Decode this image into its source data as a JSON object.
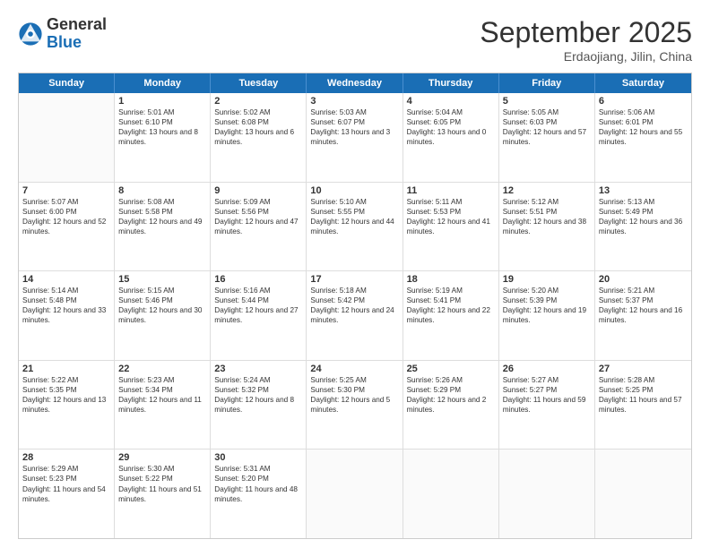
{
  "header": {
    "logo_general": "General",
    "logo_blue": "Blue",
    "month_title": "September 2025",
    "location": "Erdaojiang, Jilin, China"
  },
  "weekdays": [
    "Sunday",
    "Monday",
    "Tuesday",
    "Wednesday",
    "Thursday",
    "Friday",
    "Saturday"
  ],
  "rows": [
    [
      {
        "day": "",
        "sunrise": "",
        "sunset": "",
        "daylight": ""
      },
      {
        "day": "1",
        "sunrise": "Sunrise: 5:01 AM",
        "sunset": "Sunset: 6:10 PM",
        "daylight": "Daylight: 13 hours and 8 minutes."
      },
      {
        "day": "2",
        "sunrise": "Sunrise: 5:02 AM",
        "sunset": "Sunset: 6:08 PM",
        "daylight": "Daylight: 13 hours and 6 minutes."
      },
      {
        "day": "3",
        "sunrise": "Sunrise: 5:03 AM",
        "sunset": "Sunset: 6:07 PM",
        "daylight": "Daylight: 13 hours and 3 minutes."
      },
      {
        "day": "4",
        "sunrise": "Sunrise: 5:04 AM",
        "sunset": "Sunset: 6:05 PM",
        "daylight": "Daylight: 13 hours and 0 minutes."
      },
      {
        "day": "5",
        "sunrise": "Sunrise: 5:05 AM",
        "sunset": "Sunset: 6:03 PM",
        "daylight": "Daylight: 12 hours and 57 minutes."
      },
      {
        "day": "6",
        "sunrise": "Sunrise: 5:06 AM",
        "sunset": "Sunset: 6:01 PM",
        "daylight": "Daylight: 12 hours and 55 minutes."
      }
    ],
    [
      {
        "day": "7",
        "sunrise": "Sunrise: 5:07 AM",
        "sunset": "Sunset: 6:00 PM",
        "daylight": "Daylight: 12 hours and 52 minutes."
      },
      {
        "day": "8",
        "sunrise": "Sunrise: 5:08 AM",
        "sunset": "Sunset: 5:58 PM",
        "daylight": "Daylight: 12 hours and 49 minutes."
      },
      {
        "day": "9",
        "sunrise": "Sunrise: 5:09 AM",
        "sunset": "Sunset: 5:56 PM",
        "daylight": "Daylight: 12 hours and 47 minutes."
      },
      {
        "day": "10",
        "sunrise": "Sunrise: 5:10 AM",
        "sunset": "Sunset: 5:55 PM",
        "daylight": "Daylight: 12 hours and 44 minutes."
      },
      {
        "day": "11",
        "sunrise": "Sunrise: 5:11 AM",
        "sunset": "Sunset: 5:53 PM",
        "daylight": "Daylight: 12 hours and 41 minutes."
      },
      {
        "day": "12",
        "sunrise": "Sunrise: 5:12 AM",
        "sunset": "Sunset: 5:51 PM",
        "daylight": "Daylight: 12 hours and 38 minutes."
      },
      {
        "day": "13",
        "sunrise": "Sunrise: 5:13 AM",
        "sunset": "Sunset: 5:49 PM",
        "daylight": "Daylight: 12 hours and 36 minutes."
      }
    ],
    [
      {
        "day": "14",
        "sunrise": "Sunrise: 5:14 AM",
        "sunset": "Sunset: 5:48 PM",
        "daylight": "Daylight: 12 hours and 33 minutes."
      },
      {
        "day": "15",
        "sunrise": "Sunrise: 5:15 AM",
        "sunset": "Sunset: 5:46 PM",
        "daylight": "Daylight: 12 hours and 30 minutes."
      },
      {
        "day": "16",
        "sunrise": "Sunrise: 5:16 AM",
        "sunset": "Sunset: 5:44 PM",
        "daylight": "Daylight: 12 hours and 27 minutes."
      },
      {
        "day": "17",
        "sunrise": "Sunrise: 5:18 AM",
        "sunset": "Sunset: 5:42 PM",
        "daylight": "Daylight: 12 hours and 24 minutes."
      },
      {
        "day": "18",
        "sunrise": "Sunrise: 5:19 AM",
        "sunset": "Sunset: 5:41 PM",
        "daylight": "Daylight: 12 hours and 22 minutes."
      },
      {
        "day": "19",
        "sunrise": "Sunrise: 5:20 AM",
        "sunset": "Sunset: 5:39 PM",
        "daylight": "Daylight: 12 hours and 19 minutes."
      },
      {
        "day": "20",
        "sunrise": "Sunrise: 5:21 AM",
        "sunset": "Sunset: 5:37 PM",
        "daylight": "Daylight: 12 hours and 16 minutes."
      }
    ],
    [
      {
        "day": "21",
        "sunrise": "Sunrise: 5:22 AM",
        "sunset": "Sunset: 5:35 PM",
        "daylight": "Daylight: 12 hours and 13 minutes."
      },
      {
        "day": "22",
        "sunrise": "Sunrise: 5:23 AM",
        "sunset": "Sunset: 5:34 PM",
        "daylight": "Daylight: 12 hours and 11 minutes."
      },
      {
        "day": "23",
        "sunrise": "Sunrise: 5:24 AM",
        "sunset": "Sunset: 5:32 PM",
        "daylight": "Daylight: 12 hours and 8 minutes."
      },
      {
        "day": "24",
        "sunrise": "Sunrise: 5:25 AM",
        "sunset": "Sunset: 5:30 PM",
        "daylight": "Daylight: 12 hours and 5 minutes."
      },
      {
        "day": "25",
        "sunrise": "Sunrise: 5:26 AM",
        "sunset": "Sunset: 5:29 PM",
        "daylight": "Daylight: 12 hours and 2 minutes."
      },
      {
        "day": "26",
        "sunrise": "Sunrise: 5:27 AM",
        "sunset": "Sunset: 5:27 PM",
        "daylight": "Daylight: 11 hours and 59 minutes."
      },
      {
        "day": "27",
        "sunrise": "Sunrise: 5:28 AM",
        "sunset": "Sunset: 5:25 PM",
        "daylight": "Daylight: 11 hours and 57 minutes."
      }
    ],
    [
      {
        "day": "28",
        "sunrise": "Sunrise: 5:29 AM",
        "sunset": "Sunset: 5:23 PM",
        "daylight": "Daylight: 11 hours and 54 minutes."
      },
      {
        "day": "29",
        "sunrise": "Sunrise: 5:30 AM",
        "sunset": "Sunset: 5:22 PM",
        "daylight": "Daylight: 11 hours and 51 minutes."
      },
      {
        "day": "30",
        "sunrise": "Sunrise: 5:31 AM",
        "sunset": "Sunset: 5:20 PM",
        "daylight": "Daylight: 11 hours and 48 minutes."
      },
      {
        "day": "",
        "sunrise": "",
        "sunset": "",
        "daylight": ""
      },
      {
        "day": "",
        "sunrise": "",
        "sunset": "",
        "daylight": ""
      },
      {
        "day": "",
        "sunrise": "",
        "sunset": "",
        "daylight": ""
      },
      {
        "day": "",
        "sunrise": "",
        "sunset": "",
        "daylight": ""
      }
    ]
  ]
}
